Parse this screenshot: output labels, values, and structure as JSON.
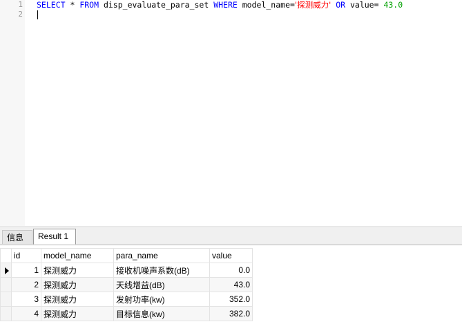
{
  "editor": {
    "line_numbers": [
      "1",
      "2"
    ],
    "query": {
      "kw_select": "SELECT",
      "star": " * ",
      "kw_from": "FROM",
      "table": " disp_evaluate_para_set ",
      "kw_where": "WHERE",
      "cond1": " model_name=",
      "str_value": "'探测威力'",
      "space": " ",
      "kw_or": "OR",
      "cond2_field": " value",
      "cond2_eq": "= ",
      "num_value": "43.0"
    }
  },
  "tabs": [
    {
      "label": "信息",
      "active": false
    },
    {
      "label": "Result 1",
      "active": true
    }
  ],
  "result": {
    "columns": [
      "id",
      "model_name",
      "para_name",
      "value"
    ],
    "rows": [
      {
        "id": "1",
        "model_name": "探测威力",
        "para_name": "接收机噪声系数(dB)",
        "value": "0.0"
      },
      {
        "id": "2",
        "model_name": "探测威力",
        "para_name": "天线增益(dB)",
        "value": "43.0"
      },
      {
        "id": "3",
        "model_name": "探测威力",
        "para_name": "发射功率(kw)",
        "value": "352.0"
      },
      {
        "id": "4",
        "model_name": "探测威力",
        "para_name": "目标信息(kw)",
        "value": "382.0"
      }
    ],
    "selected_row": 0
  },
  "colors": {
    "keyword": "#0000ff",
    "string": "#ff0000",
    "number": "#00a000",
    "selected_header": "#cfe4f7"
  }
}
